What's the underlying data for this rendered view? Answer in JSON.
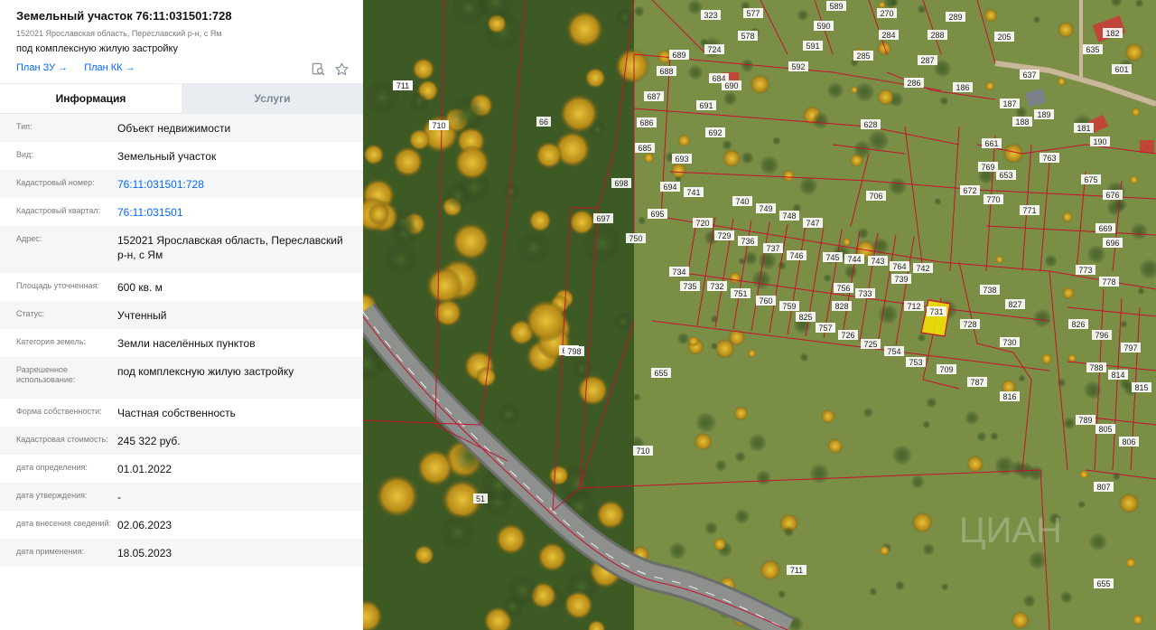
{
  "header": {
    "title": "Земельный участок 76:11:031501:728",
    "address_short": "152021 Ярославская область, Переславский р-н, с Ям",
    "usage": "под комплексную жилую застройку",
    "link_plan_zu": "План ЗУ →",
    "link_plan_kk": "План КК →",
    "icon_search": "search-doc-icon",
    "icon_favorite": "star-icon"
  },
  "tabs": {
    "info": "Информация",
    "services": "Услуги"
  },
  "rows": [
    {
      "key": "Тип:",
      "value": "Объект недвижимости"
    },
    {
      "key": "Вид:",
      "value": "Земельный участок"
    },
    {
      "key": "Кадастровый номер:",
      "value": "76:11:031501:728"
    },
    {
      "key": "Кадастровый квартал:",
      "value": "76:11:031501"
    },
    {
      "key": "Адрес:",
      "value": "152021 Ярославская область, Переславский р-н, с Ям"
    },
    {
      "key": "Площадь уточненная:",
      "value": "600 кв. м"
    },
    {
      "key": "Статус:",
      "value": "Учтенный"
    },
    {
      "key": "Категория земель:",
      "value": "Земли населённых пунктов"
    },
    {
      "key": "Разрешенное использование:",
      "value": "под комплексную жилую застройку"
    },
    {
      "key": "Форма собственности:",
      "value": "Частная собственность"
    },
    {
      "key": "Кадастровая стоимость:",
      "value": "245 322 руб."
    },
    {
      "key": "дата определения:",
      "value": "01.01.2022"
    },
    {
      "key": "дата утверждения:",
      "value": "-"
    },
    {
      "key": "дата внесения сведений:",
      "value": "02.06.2023"
    },
    {
      "key": "дата применения:",
      "value": "18.05.2023"
    }
  ],
  "map": {
    "parcel_labels": [
      "648",
      "722",
      "66",
      "682",
      "51",
      "589",
      "270",
      "289",
      "205",
      "635",
      "182",
      "577",
      "323",
      "578",
      "724",
      "590",
      "284",
      "288",
      "591",
      "285",
      "287",
      "601",
      "688",
      "689",
      "592",
      "637",
      "684",
      "690",
      "286",
      "186",
      "187",
      "188",
      "189",
      "687",
      "691",
      "628",
      "181",
      "686",
      "692",
      "190",
      "685",
      "693",
      "661",
      "763",
      "706",
      "694",
      "769",
      "653",
      "675",
      "698",
      "697",
      "695",
      "741",
      "740",
      "749",
      "748",
      "747",
      "672",
      "770",
      "771",
      "676",
      "720",
      "729",
      "736",
      "737",
      "746",
      "745",
      "744",
      "743",
      "764",
      "669",
      "696",
      "750",
      "734",
      "735",
      "739",
      "742",
      "773",
      "778",
      "732",
      "751",
      "760",
      "759",
      "756",
      "733",
      "738",
      "827",
      "828",
      "712",
      "731",
      "728",
      "825",
      "757",
      "726",
      "725",
      "754",
      "753",
      "730",
      "826",
      "796",
      "797",
      "798",
      "655",
      "709",
      "787",
      "788",
      "814",
      "815",
      "816",
      "789",
      "805",
      "806",
      "807",
      "710",
      "711",
      "655",
      "711",
      "710"
    ],
    "selected_parcel": "728",
    "watermark": "ЦИАН"
  },
  "colors": {
    "accent": "#0468ff",
    "boundary": "#c8102e",
    "selected": "#f5e400"
  }
}
